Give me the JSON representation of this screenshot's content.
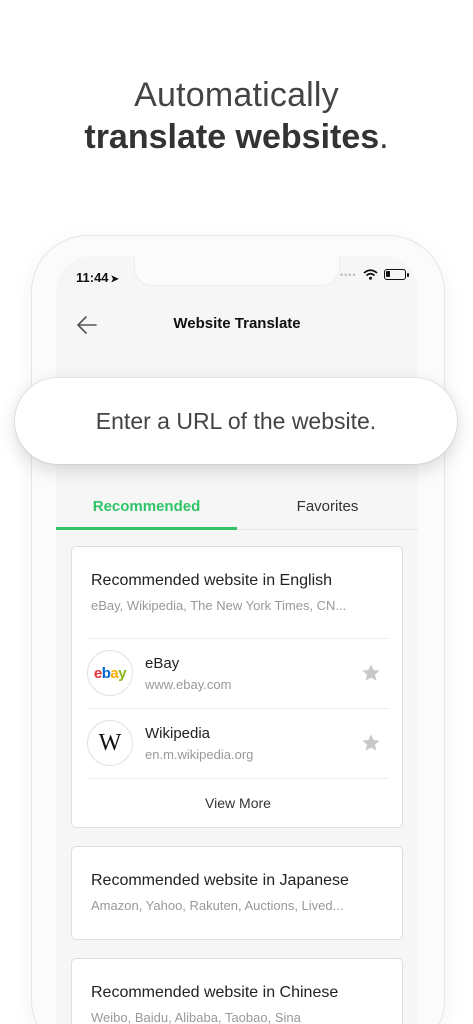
{
  "headline": {
    "line1": "Automatically",
    "line2_bold": "translate websites",
    "line2_end": "."
  },
  "status": {
    "time": "11:44"
  },
  "nav": {
    "title": "Website Translate"
  },
  "url_input": {
    "placeholder": "Enter a URL of the website."
  },
  "tabs": [
    {
      "label": "Recommended",
      "active": true
    },
    {
      "label": "Favorites",
      "active": false
    }
  ],
  "cards": [
    {
      "title": "Recommended website in English",
      "subtitle": "eBay, Wikipedia, The New York Times, CN...",
      "sites": [
        {
          "name": "eBay",
          "url": "www.ebay.com",
          "logo": "ebay-logo"
        },
        {
          "name": "Wikipedia",
          "url": "en.m.wikipedia.org",
          "logo": "wikipedia-logo"
        }
      ],
      "view_more": "View More"
    },
    {
      "title": "Recommended website in Japanese",
      "subtitle": "Amazon, Yahoo, Rakuten, Auctions, Lived..."
    },
    {
      "title": "Recommended website in Chinese",
      "subtitle": "Weibo, Baidu, Alibaba, Taobao, Sina"
    }
  ],
  "logo_text": {
    "ebay": [
      "e",
      "b",
      "a",
      "y"
    ],
    "wiki": "W"
  },
  "colors": {
    "accent": "#2ec467",
    "star": "#c8c8c8"
  }
}
